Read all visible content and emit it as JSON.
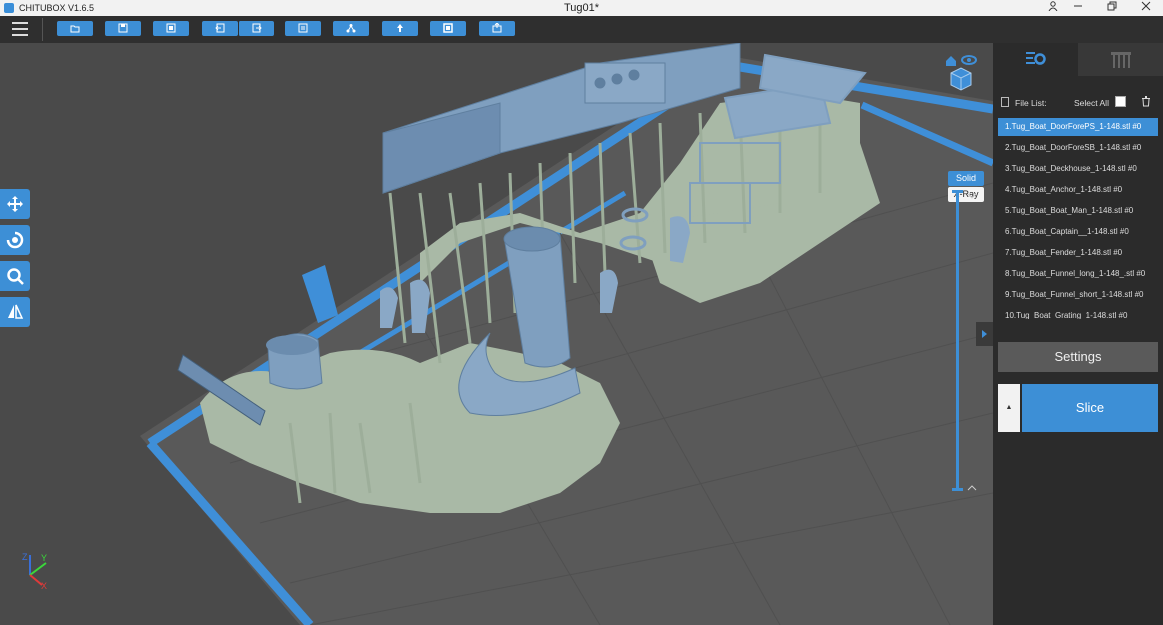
{
  "titlebar": {
    "app_name": "CHITUBOX V1.6.5",
    "doc_title": "Tug01*"
  },
  "toolbar": {
    "buttons": [
      "open-file-icon",
      "save-icon",
      "import-icon",
      "undo-icon",
      "redo-icon",
      "layers-icon",
      "network-icon",
      "support-icon",
      "hollow-icon",
      "add-model-icon"
    ]
  },
  "viewport": {
    "view_modes": {
      "solid": "Solid",
      "xray": "X-Ray"
    },
    "axes": {
      "x": "X",
      "y": "Y",
      "z": "Z"
    }
  },
  "panel": {
    "file_list_label": "File List:",
    "select_all_label": "Select All",
    "files": [
      "1.Tug_Boat_DoorForePS_1-148.stl #0",
      "2.Tug_Boat_DoorForeSB_1-148.stl #0",
      "3.Tug_Boat_Deckhouse_1-148.stl #0",
      "4.Tug_Boat_Anchor_1-148.stl #0",
      "5.Tug_Boat_Boat_Man_1-148.stl #0",
      "6.Tug_Boat_Captain__1-148.stl #0",
      "7.Tug_Boat_Fender_1-148.stl #0",
      "8.Tug_Boat_Funnel_long_1-148_.stl #0",
      "9.Tug_Boat_Funnel_short_1-148.stl #0",
      "10.Tug_Boat_Grating_1-148.stl #0"
    ],
    "settings_label": "Settings",
    "slice_label": "Slice"
  },
  "colors": {
    "accent": "#3d8fd6",
    "plate": "#595959",
    "model": "#7f9fbf",
    "support": "#a9b9a6"
  }
}
